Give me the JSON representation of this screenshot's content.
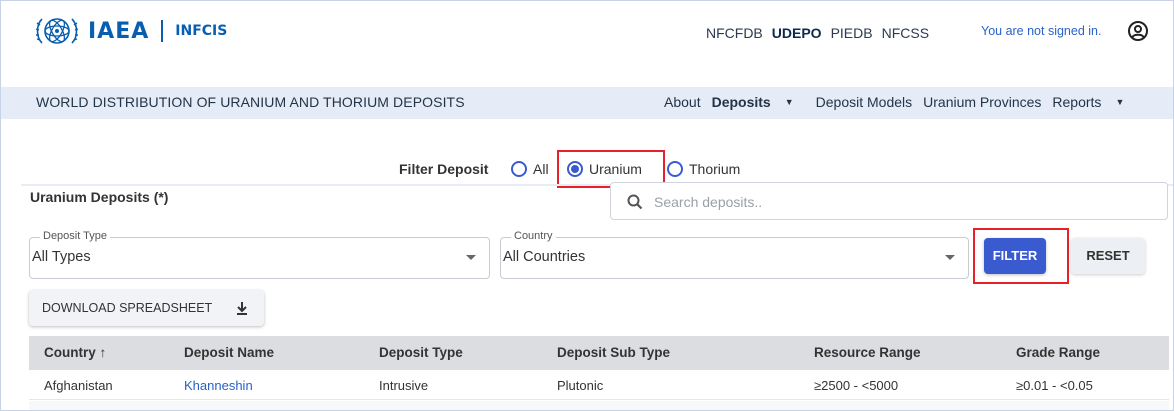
{
  "brand": {
    "logo_text": "IAEA",
    "sub": "INFCIS"
  },
  "apps": [
    {
      "label": "NFCFDB",
      "active": false
    },
    {
      "label": "UDEPO",
      "active": true
    },
    {
      "label": "PIEDB",
      "active": false
    },
    {
      "label": "NFCSS",
      "active": false
    }
  ],
  "signin_text": "You are not signed in.",
  "site_title": "WORLD DISTRIBUTION OF URANIUM AND THORIUM DEPOSITS",
  "nav": {
    "about": "About",
    "deposits": "Deposits",
    "deposit_models": "Deposit Models",
    "uranium_provinces": "Uranium Provinces",
    "reports": "Reports"
  },
  "filter": {
    "label": "Filter Deposit",
    "options": [
      "All",
      "Uranium",
      "Thorium"
    ],
    "selected": "Uranium"
  },
  "main": {
    "title": "Uranium Deposits (*)",
    "search_placeholder": "Search deposits.."
  },
  "fields": {
    "deposit_type": {
      "legend": "Deposit Type",
      "value": "All Types"
    },
    "country": {
      "legend": "Country",
      "value": "All Countries"
    }
  },
  "buttons": {
    "filter": "FILTER",
    "reset": "RESET",
    "download": "DOWNLOAD SPREADSHEET"
  },
  "table": {
    "headers": [
      "Country ↑",
      "Deposit Name",
      "Deposit Type",
      "Deposit Sub Type",
      "Resource Range",
      "Grade Range"
    ],
    "rows": [
      [
        "Afghanistan",
        "Khanneshin",
        "Intrusive",
        "Plutonic",
        "≥2500 - <5000",
        "≥0.01 - <0.05"
      ]
    ]
  },
  "colors": {
    "brand_blue": "#0a5eb0",
    "accent": "#3a5bd0",
    "highlight": "#e8202a",
    "nav_bg": "#e5ecf7"
  }
}
